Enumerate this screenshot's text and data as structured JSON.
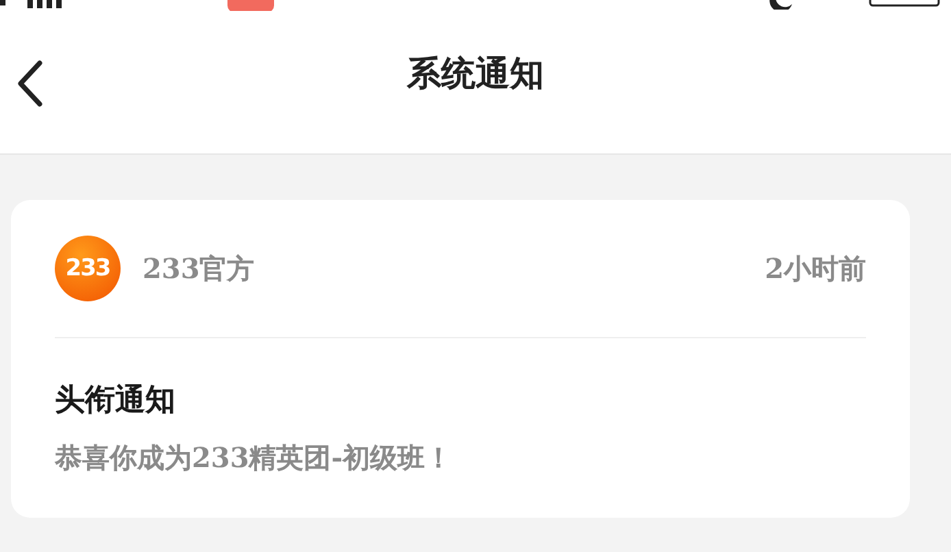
{
  "nav": {
    "title": "系统通知"
  },
  "notification": {
    "avatar_text": "233",
    "sender": "233官方",
    "time": "2小时前",
    "title": "头衔通知",
    "body": "恭喜你成为233精英团-初级班！"
  }
}
